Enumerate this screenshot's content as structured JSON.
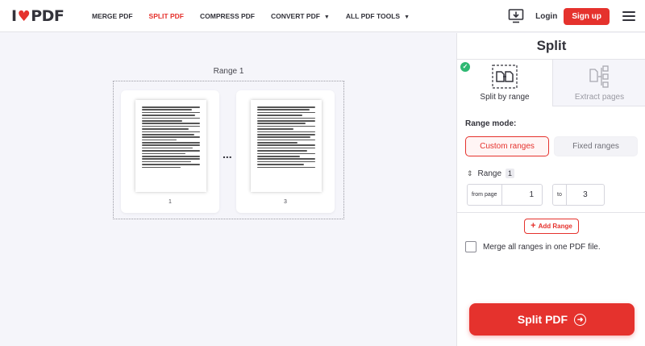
{
  "header": {
    "logo": {
      "left": "I",
      "heart": "♥",
      "right": "PDF"
    },
    "nav": [
      {
        "label": "MERGE PDF",
        "active": false
      },
      {
        "label": "SPLIT PDF",
        "active": true
      },
      {
        "label": "COMPRESS PDF",
        "active": false
      },
      {
        "label": "CONVERT PDF",
        "active": false,
        "dropdown": true
      },
      {
        "label": "ALL PDF TOOLS",
        "active": false,
        "dropdown": true
      }
    ],
    "desktop_icon": "desktop-download-icon",
    "login_label": "Login",
    "signup_label": "Sign up",
    "menu_icon": "hamburger-menu-icon"
  },
  "workspace": {
    "range_label": "Range 1",
    "pages": [
      {
        "number": "1"
      },
      {
        "number": "3"
      }
    ],
    "ellipsis": "..."
  },
  "sidebar": {
    "title": "Split",
    "tabs": [
      {
        "label": "Split by range",
        "active": true,
        "icon": "split-range-icon"
      },
      {
        "label": "Extract pages",
        "active": false,
        "icon": "extract-pages-icon"
      }
    ],
    "range_mode_label": "Range mode:",
    "modes": [
      {
        "label": "Custom ranges",
        "active": true
      },
      {
        "label": "Fixed ranges",
        "active": false
      }
    ],
    "range": {
      "label": "Range",
      "number": "1",
      "from_label": "from page",
      "from_value": "1",
      "to_label": "to",
      "to_value": "3"
    },
    "add_range_label": "Add Range",
    "merge_label": "Merge all ranges in one PDF file.",
    "split_button_label": "Split PDF"
  },
  "colors": {
    "accent": "#e5322d",
    "success": "#2eb872",
    "text": "#33333b",
    "workspace_bg": "#f5f5fa"
  }
}
